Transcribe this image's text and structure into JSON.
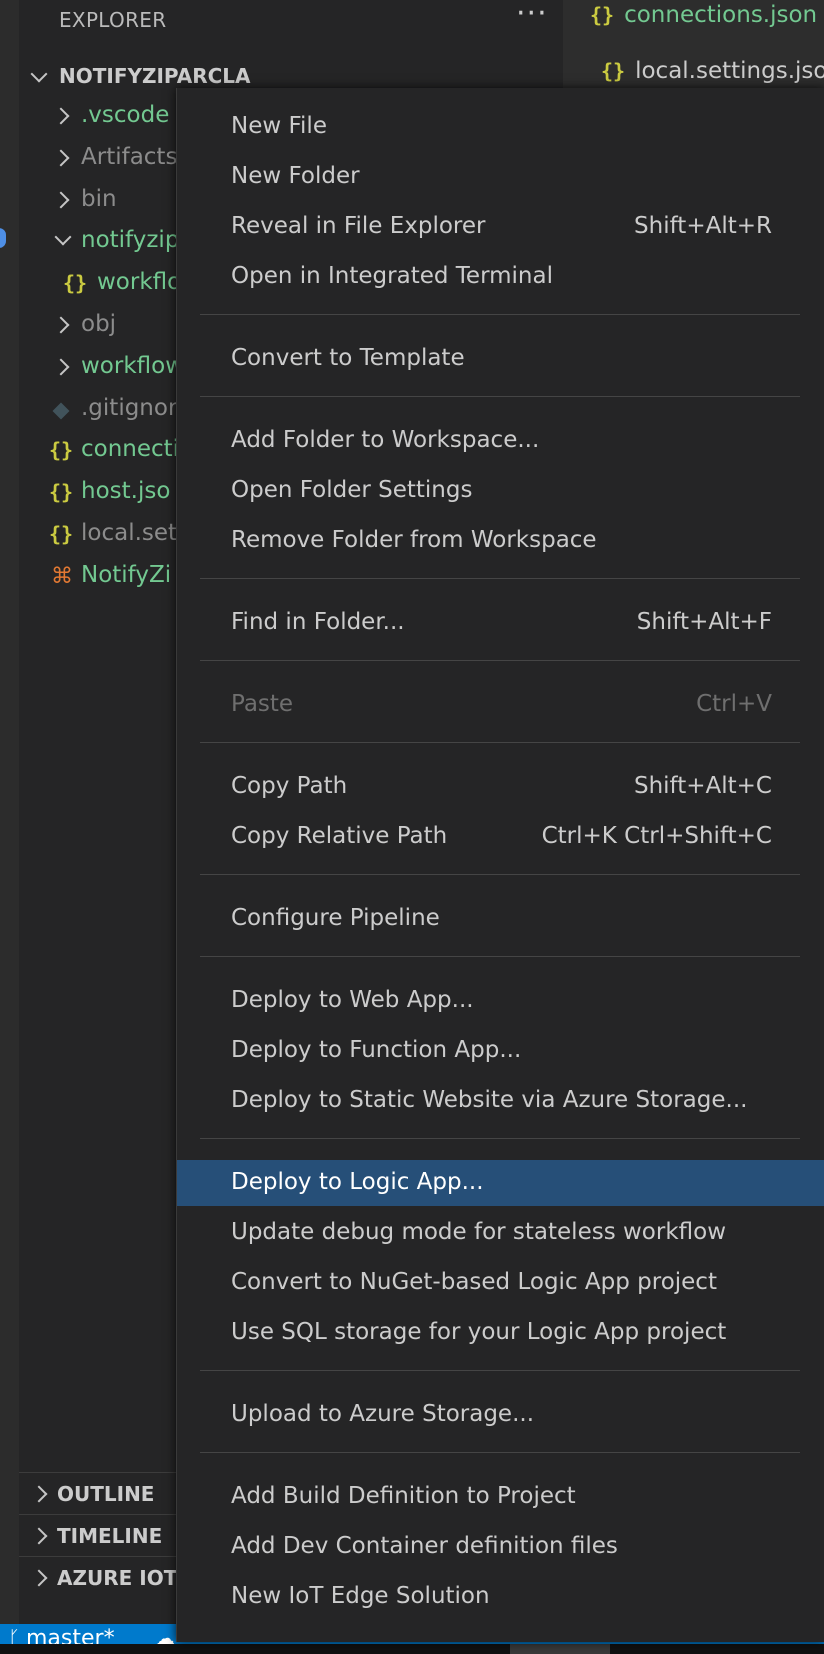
{
  "sidebar": {
    "title": "EXPLORER",
    "more_label": "···",
    "folder_name": "NOTIFYZIPARCLA",
    "tree": [
      {
        "label": ".vscode",
        "kind": "folder"
      },
      {
        "label": "Artifacts",
        "kind": "folder"
      },
      {
        "label": "bin",
        "kind": "folder"
      },
      {
        "label": "notifyzip",
        "kind": "folder-open"
      },
      {
        "label": "workflo",
        "kind": "json-child"
      },
      {
        "label": "obj",
        "kind": "folder"
      },
      {
        "label": "workflow",
        "kind": "folder"
      },
      {
        "label": ".gitignor",
        "kind": "git"
      },
      {
        "label": "connecti",
        "kind": "json"
      },
      {
        "label": "host.jso",
        "kind": "json"
      },
      {
        "label": "local.set",
        "kind": "json"
      },
      {
        "label": "NotifyZi",
        "kind": "rss"
      }
    ],
    "sections": [
      {
        "label": "OUTLINE"
      },
      {
        "label": "TIMELINE"
      },
      {
        "label": "AZURE IOT"
      }
    ]
  },
  "tabs": [
    {
      "label": "connections.json"
    },
    {
      "label": "local.settings.json"
    }
  ],
  "icons": {
    "json": "{}",
    "rss": "⌘",
    "branch": "ᚴ",
    "sync": "☁"
  },
  "statusbar": {
    "branch": "master*"
  },
  "context_menu": {
    "groups": [
      [
        {
          "label": "New File",
          "shortcut": ""
        },
        {
          "label": "New Folder",
          "shortcut": ""
        },
        {
          "label": "Reveal in File Explorer",
          "shortcut": "Shift+Alt+R"
        },
        {
          "label": "Open in Integrated Terminal",
          "shortcut": ""
        }
      ],
      [
        {
          "label": "Convert to Template",
          "shortcut": ""
        }
      ],
      [
        {
          "label": "Add Folder to Workspace...",
          "shortcut": ""
        },
        {
          "label": "Open Folder Settings",
          "shortcut": ""
        },
        {
          "label": "Remove Folder from Workspace",
          "shortcut": ""
        }
      ],
      [
        {
          "label": "Find in Folder...",
          "shortcut": "Shift+Alt+F"
        }
      ],
      [
        {
          "label": "Paste",
          "shortcut": "Ctrl+V",
          "disabled": true
        }
      ],
      [
        {
          "label": "Copy Path",
          "shortcut": "Shift+Alt+C"
        },
        {
          "label": "Copy Relative Path",
          "shortcut": "Ctrl+K Ctrl+Shift+C"
        }
      ],
      [
        {
          "label": "Configure Pipeline",
          "shortcut": ""
        }
      ],
      [
        {
          "label": "Deploy to Web App...",
          "shortcut": ""
        },
        {
          "label": "Deploy to Function App...",
          "shortcut": ""
        },
        {
          "label": "Deploy to Static Website via Azure Storage...",
          "shortcut": ""
        }
      ],
      [
        {
          "label": "Deploy to Logic App...",
          "shortcut": "",
          "selected": true
        },
        {
          "label": "Update debug mode for stateless workflow",
          "shortcut": ""
        },
        {
          "label": "Convert to NuGet-based Logic App project",
          "shortcut": ""
        },
        {
          "label": "Use SQL storage for your Logic App project",
          "shortcut": ""
        }
      ],
      [
        {
          "label": "Upload to Azure Storage...",
          "shortcut": ""
        }
      ],
      [
        {
          "label": "Add Build Definition to Project",
          "shortcut": ""
        },
        {
          "label": "Add Dev Container definition files",
          "shortcut": ""
        },
        {
          "label": "New IoT Edge Solution",
          "shortcut": ""
        }
      ]
    ]
  }
}
